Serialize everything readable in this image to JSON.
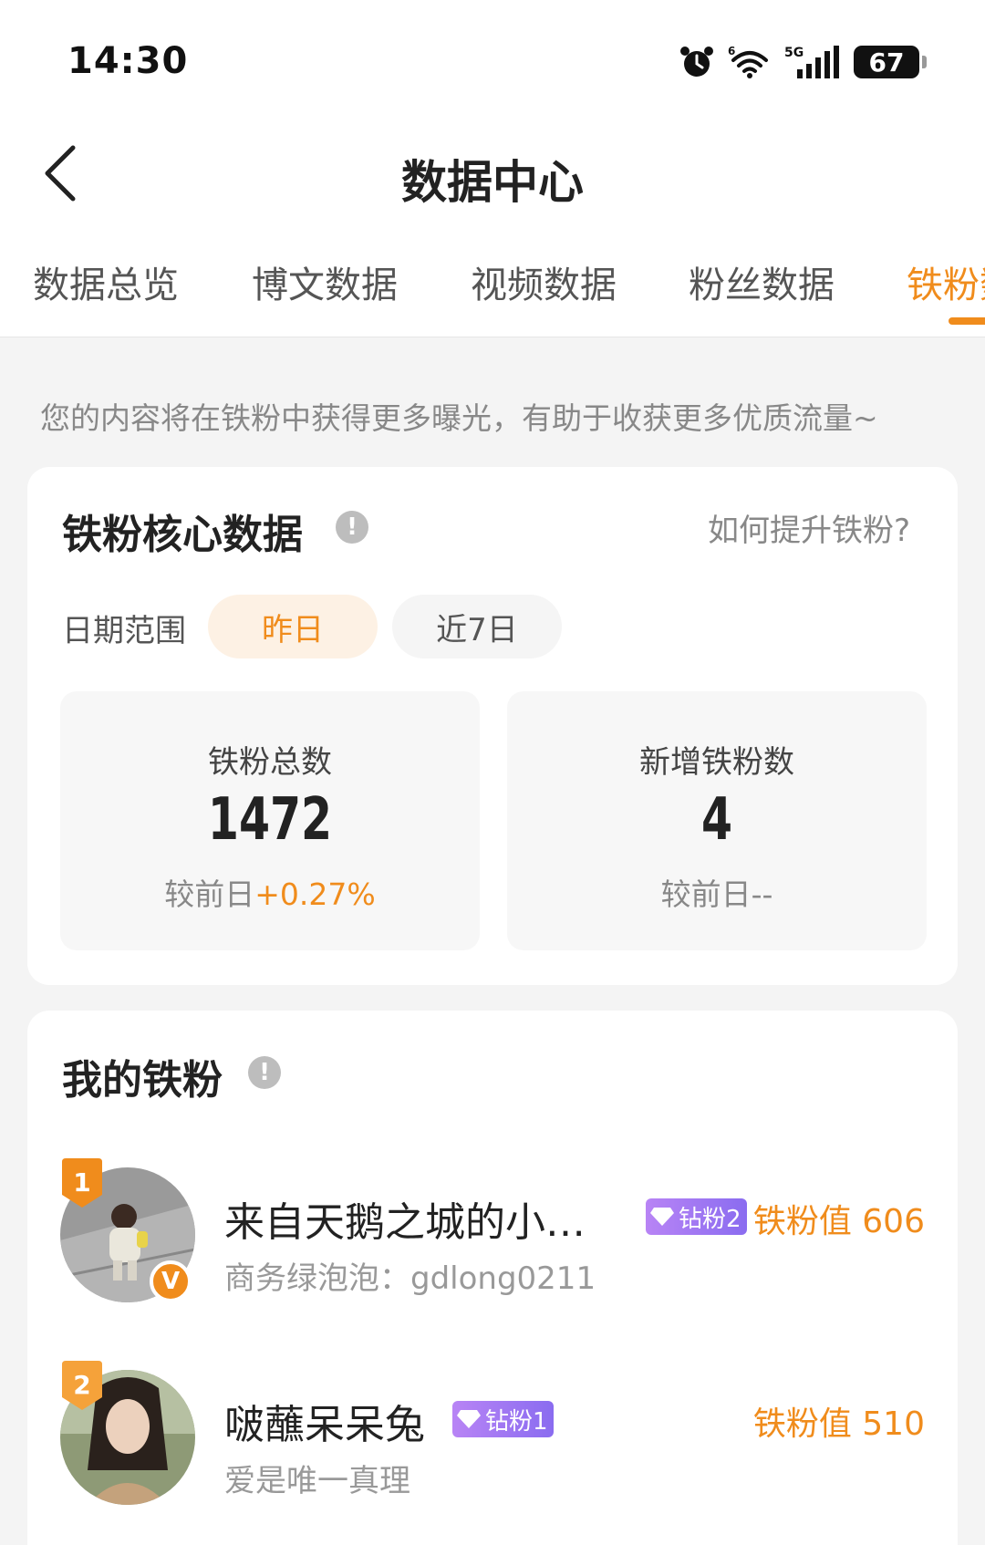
{
  "status_bar": {
    "time": "14:30",
    "battery": "67",
    "network": "5G"
  },
  "nav": {
    "title": "数据中心"
  },
  "tabs": [
    "数据总览",
    "博文数据",
    "视频数据",
    "粉丝数据",
    "铁粉数据"
  ],
  "active_tab": "铁粉数据",
  "hint": "您的内容将在铁粉中获得更多曝光，有助于收获更多优质流量~",
  "core": {
    "title": "铁粉核心数据",
    "howto": "如何提升铁粉?",
    "range_label": "日期范围",
    "range_options": [
      "昨日",
      "近7日"
    ],
    "total": {
      "label": "铁粉总数",
      "value": "1472",
      "compare_prefix": "较前日",
      "compare_value": "+0.27%"
    },
    "new": {
      "label": "新增铁粉数",
      "value": "4",
      "compare_prefix": "较前日",
      "compare_value": "--"
    }
  },
  "fans": {
    "title": "我的铁粉",
    "list": [
      {
        "rank": "1",
        "name": "来自天鹅之城的小…",
        "badge": "钻粉2",
        "value_label": "铁粉值 606",
        "sub": "商务绿泡泡：gdlong0211",
        "verified": "V"
      },
      {
        "rank": "2",
        "name": "啵蘸呆呆兔",
        "badge": "钻粉1",
        "value_label": "铁粉值 510",
        "sub": "爱是唯一真理"
      }
    ]
  },
  "colors": {
    "accent": "#f08c1c",
    "badge_purple": "#9a74f2"
  }
}
